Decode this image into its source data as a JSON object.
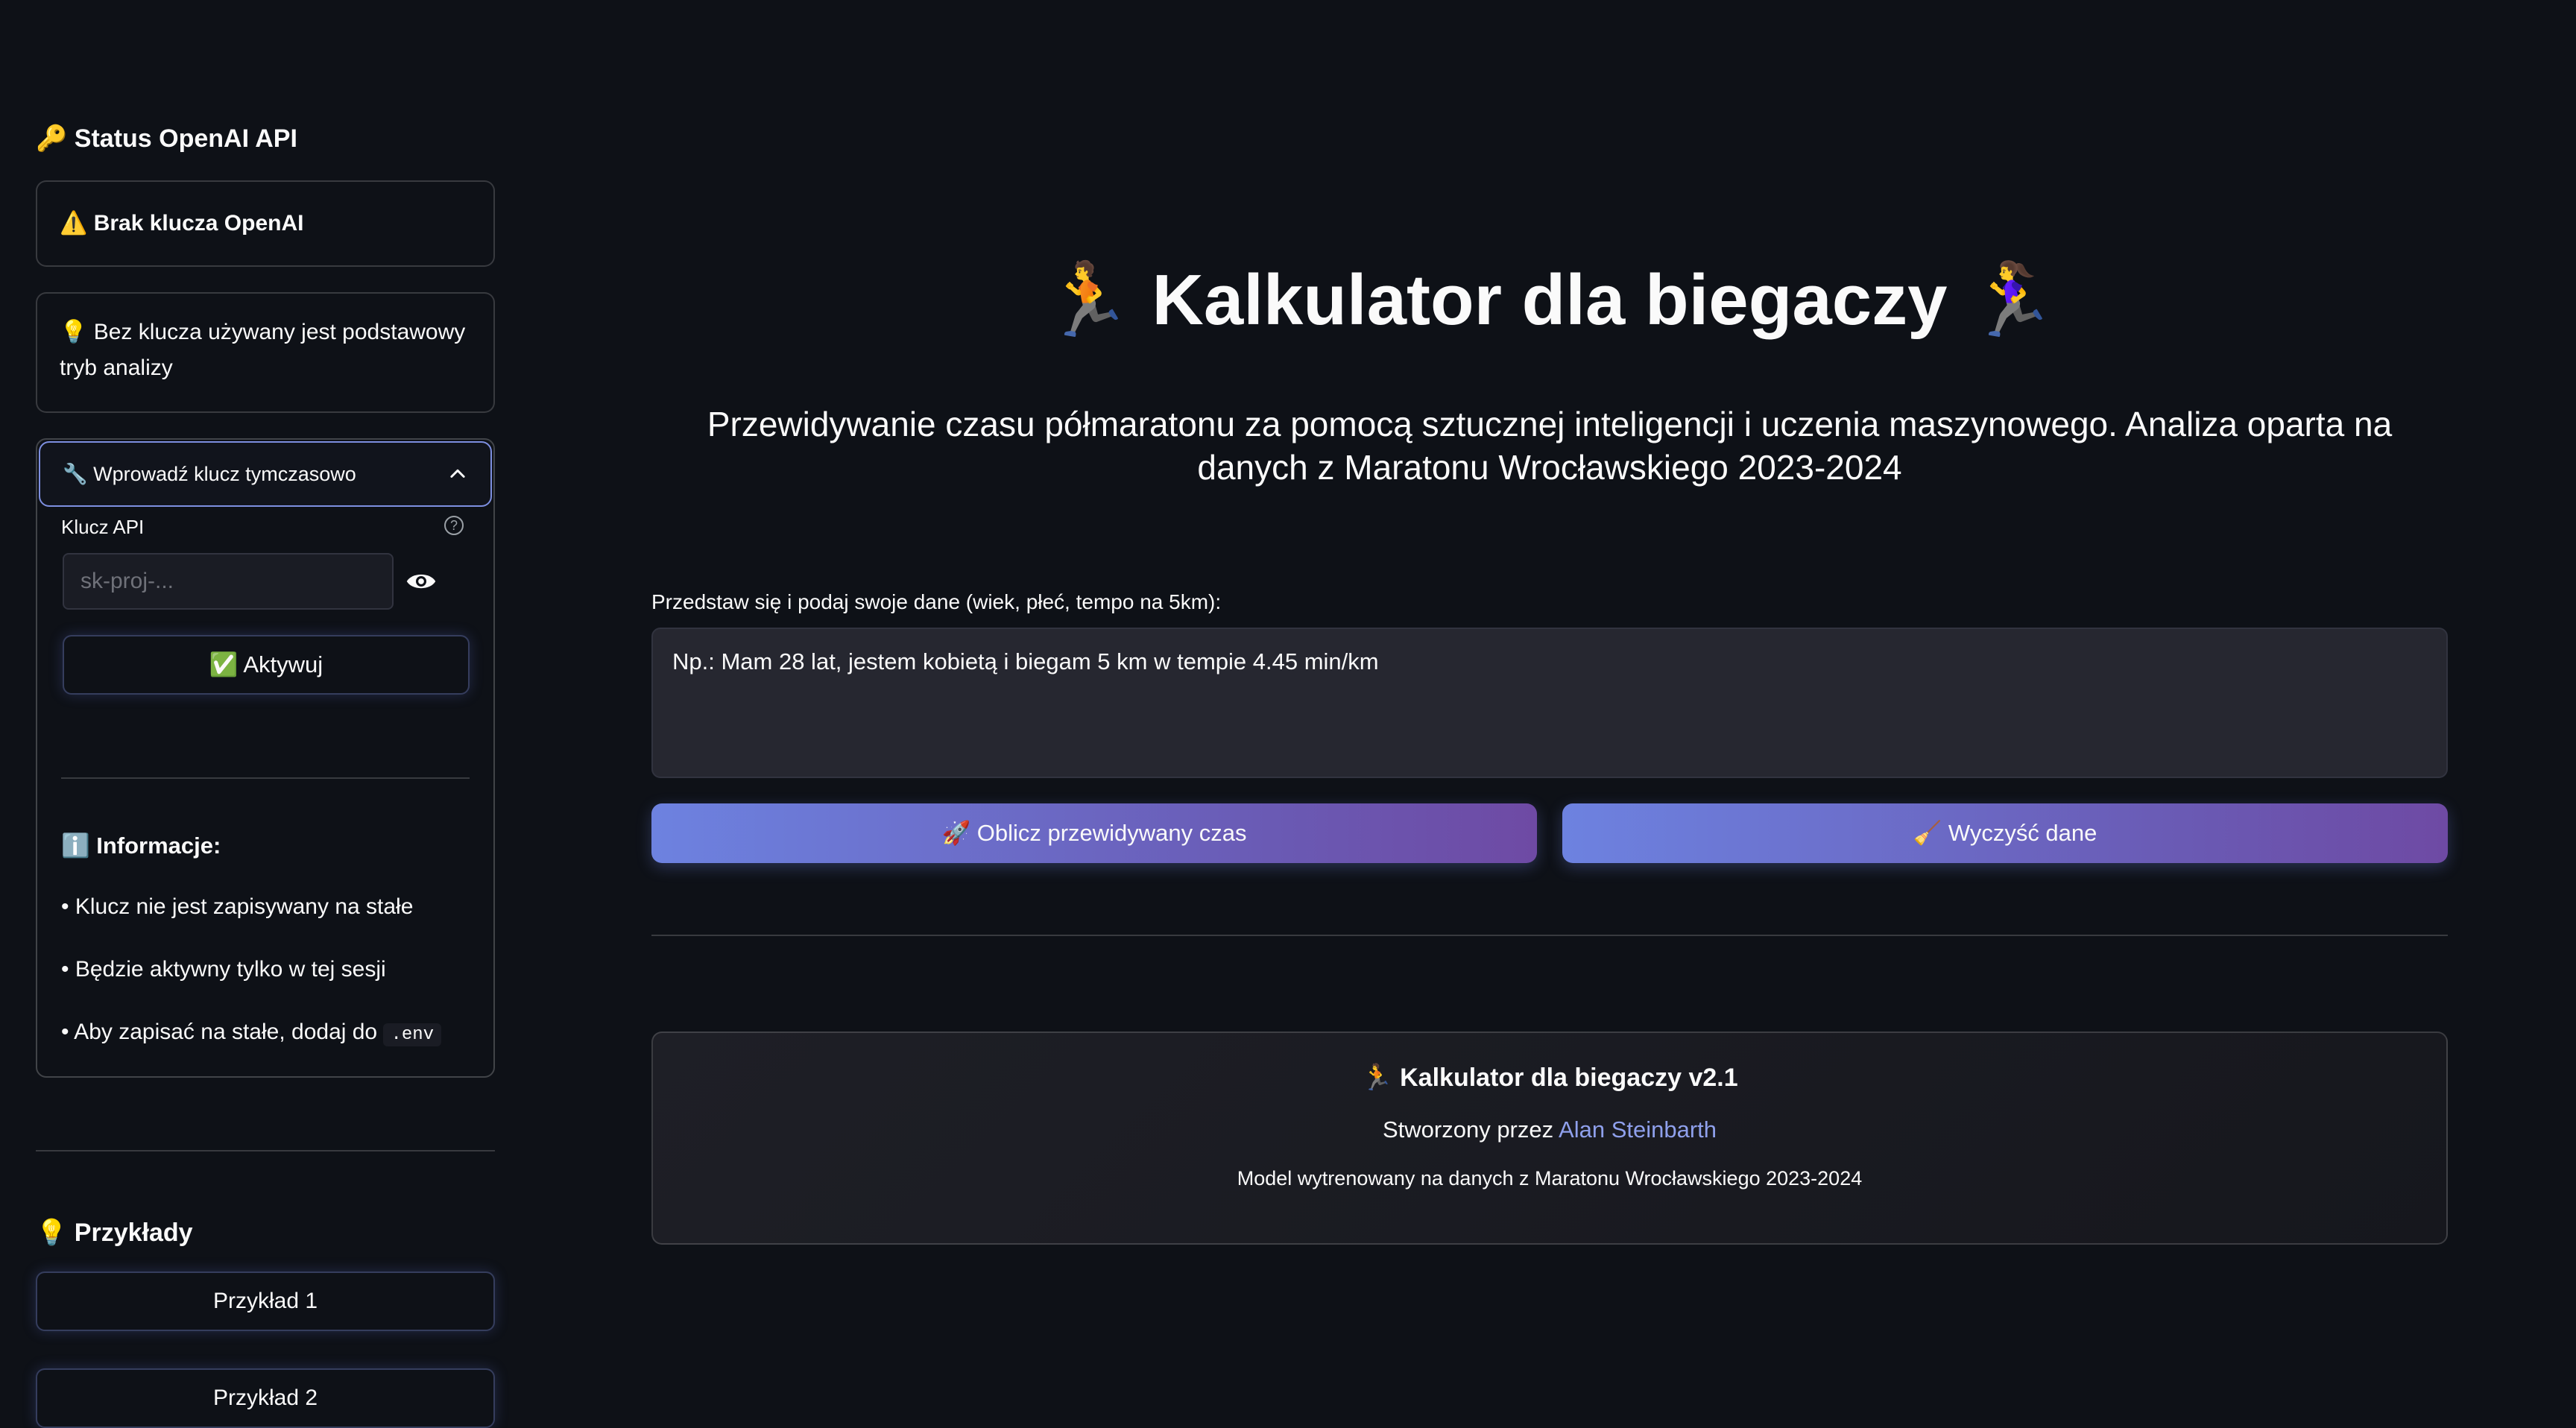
{
  "sidebar": {
    "status_heading": "Status OpenAI API",
    "status_heading_icon": "key-icon",
    "no_key_warning": "Brak klucza OpenAI",
    "no_key_icon": "warning-icon",
    "basic_mode_info": "Bez klucza używany jest podstawowy tryb analizy",
    "basic_mode_icon": "lightbulb-icon",
    "expander": {
      "title": "Wprowadź klucz tymczasowo",
      "icon": "wrench-icon",
      "expanded": true,
      "api_label": "Klucz API",
      "api_placeholder": "sk-proj-...",
      "activate_button": "Aktywuj",
      "activate_icon": "check-icon",
      "info_title": "Informacje:",
      "info_icon": "info-icon",
      "info_lines": [
        "• Klucz nie jest zapisywany na stałe",
        "• Będzie aktywny tylko w tej sesji",
        "• Aby zapisać na stałe, dodaj do"
      ],
      "env_code": ".env"
    },
    "examples_heading": "Przykłady",
    "examples_icon": "lightbulb-icon",
    "examples": [
      "Przykład 1",
      "Przykład 2"
    ]
  },
  "main": {
    "title": "Kalkulator dla biegaczy",
    "title_icons": [
      "man-running-icon",
      "woman-running-icon"
    ],
    "subtitle": "Przewidywanie czasu półmaratonu za pomocą sztucznej inteligencji i uczenia maszynowego. Analiza oparta na danych z Maratonu Wrocławskiego 2023-2024",
    "input_label": "Przedstaw się i podaj swoje dane (wiek, płeć, tempo na 5km):",
    "input_placeholder": "Np.: Mam 28 lat, jestem kobietą i biegam 5 km w tempie 4.45 min/km",
    "calc_button": "Oblicz przewidywany czas",
    "calc_icon": "rocket-icon",
    "clear_button": "Wyczyść dane",
    "clear_icon": "broom-icon",
    "footer": {
      "title": "Kalkulator dla biegaczy v2.1",
      "title_icon": "runner-icon",
      "created_by": "Stworzony przez",
      "author": "Alan Steinbarth",
      "model_note": "Model wytrenowany na danych z Maratonu Wrocławskiego 2023-2024"
    }
  },
  "colors": {
    "background": "#0e1117",
    "accent_gradient_start": "#6d82e0",
    "accent_gradient_end": "#6e4aa4",
    "link": "#8fa0ec"
  }
}
